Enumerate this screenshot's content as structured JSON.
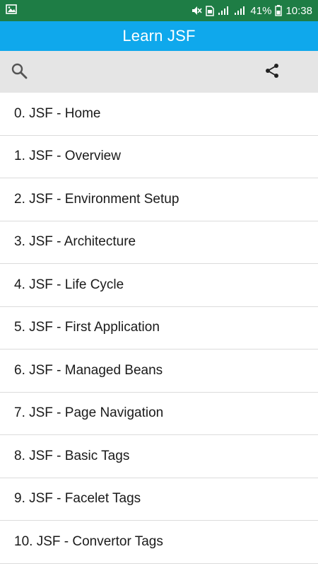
{
  "status_bar": {
    "battery_percent": "41%",
    "time": "10:38",
    "icons": [
      "image-icon",
      "mute-icon",
      "sim-icon",
      "signal-icon",
      "signal-icon",
      "battery-icon"
    ]
  },
  "app_bar": {
    "title": "Learn JSF"
  },
  "toolbar": {
    "search_icon": "search-icon",
    "share_icon": "share-icon"
  },
  "topics": [
    {
      "label": "0. JSF - Home"
    },
    {
      "label": "1. JSF - Overview"
    },
    {
      "label": "2. JSF - Environment Setup"
    },
    {
      "label": "3. JSF - Architecture"
    },
    {
      "label": "4. JSF - Life Cycle"
    },
    {
      "label": "5. JSF - First Application"
    },
    {
      "label": "6. JSF - Managed Beans"
    },
    {
      "label": "7. JSF - Page Navigation"
    },
    {
      "label": "8. JSF - Basic Tags"
    },
    {
      "label": "9. JSF - Facelet Tags"
    },
    {
      "label": "10. JSF - Convertor Tags"
    }
  ],
  "colors": {
    "status_bar": "#1e7d45",
    "app_bar": "#0fa8ec",
    "toolbar": "#e5e5e5",
    "divider": "#dcdcdc"
  }
}
